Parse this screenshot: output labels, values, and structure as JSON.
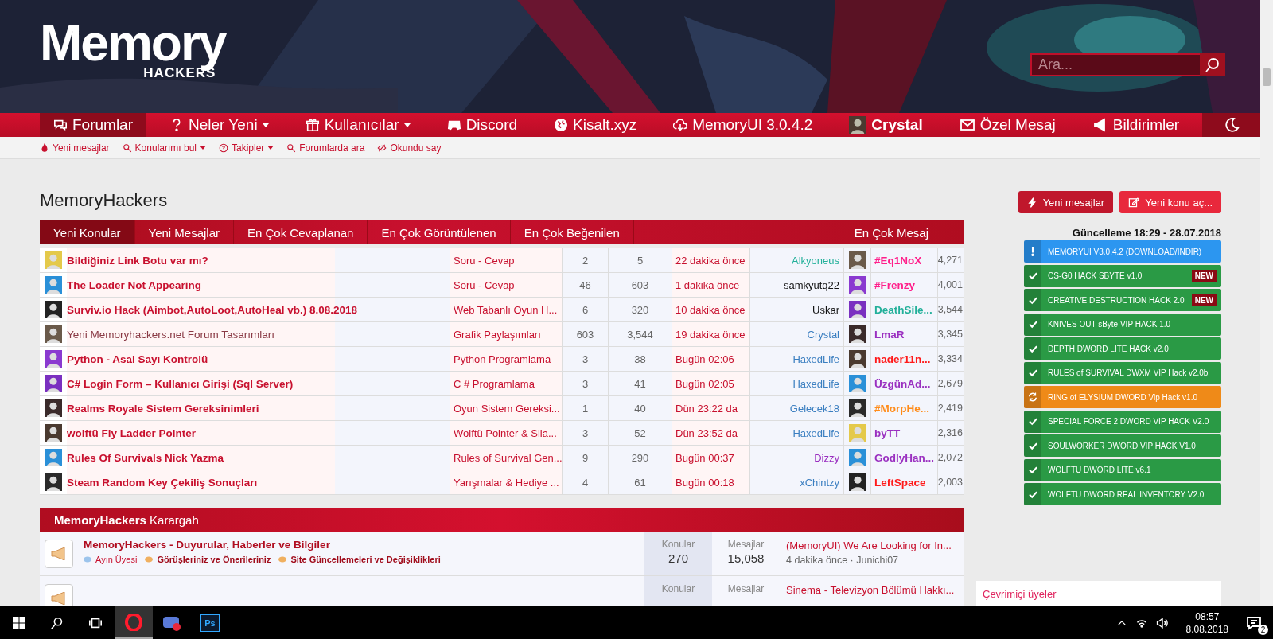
{
  "header": {
    "logo": {
      "title": "Memory",
      "subtitle": "HACKERS"
    },
    "search": {
      "placeholder": "Ara..."
    }
  },
  "nav": {
    "items": [
      {
        "label": "Forumlar",
        "selected": true,
        "dropdown": false
      },
      {
        "label": "Neler Yeni",
        "selected": false,
        "dropdown": true
      },
      {
        "label": "Kullanıcılar",
        "selected": false,
        "dropdown": true
      },
      {
        "label": "Discord",
        "selected": false,
        "dropdown": false
      },
      {
        "label": "Kisalt.xyz",
        "selected": false,
        "dropdown": false
      },
      {
        "label": "MemoryUI 3.0.4.2",
        "selected": false,
        "dropdown": false
      }
    ],
    "user": "Crystal",
    "right_items": [
      {
        "label": "Özel Mesaj"
      },
      {
        "label": "Bildirimler"
      }
    ]
  },
  "subnav": [
    {
      "label": "Yeni mesajlar",
      "dropdown": false
    },
    {
      "label": "Konularımı bul",
      "dropdown": true
    },
    {
      "label": "Takipler",
      "dropdown": true
    },
    {
      "label": "Forumlarda ara",
      "dropdown": false
    },
    {
      "label": "Okundu say",
      "dropdown": false
    }
  ],
  "page_title": "MemoryHackers",
  "action_buttons": [
    {
      "label": "Yeni mesajlar",
      "kind": "dark"
    },
    {
      "label": "Yeni konu aç...",
      "kind": "bright"
    }
  ],
  "tabs": [
    {
      "label": "Yeni Konular",
      "selected": true
    },
    {
      "label": "Yeni Mesajlar",
      "selected": false
    },
    {
      "label": "En Çok Cevaplanan",
      "selected": false
    },
    {
      "label": "En Çok Görüntülenen",
      "selected": false
    },
    {
      "label": "En Çok Beğenilen",
      "selected": false
    }
  ],
  "tabs_right": "En Çok Mesaj",
  "threads": [
    {
      "title": "Bildiğiniz Link Botu var mı?",
      "unread": true,
      "forum": "Soru - Cevap",
      "replies": "2",
      "views": "5",
      "time": "22 dakika önce",
      "user": {
        "name": "Alkyoneus",
        "color": "#22b09a"
      },
      "top_user": {
        "name": "#Eq1NoX",
        "color": "#ff1f8a",
        "count": "4,271"
      }
    },
    {
      "title": "The Loader Not Appearing",
      "unread": true,
      "forum": "Soru - Cevap",
      "replies": "46",
      "views": "603",
      "time": "1 dakika önce",
      "user": {
        "name": "samkyutq22",
        "color": "#141414"
      },
      "top_user": {
        "name": "#Frenzy",
        "color": "#ff1f8a",
        "count": "4,001"
      }
    },
    {
      "title": "Surviv.io Hack (Aimbot,AutoLoot,AutoHeal vb.) 8.08.2018",
      "unread": true,
      "forum": "Web Tabanlı Oyun H...",
      "replies": "6",
      "views": "320",
      "time": "10 dakika önce",
      "user": {
        "name": "Uskar",
        "color": "#141414"
      },
      "top_user": {
        "name": "DeathSile...",
        "color": "#22b09a",
        "count": "3,544"
      }
    },
    {
      "title": "Yeni Memoryhackers.net Forum Tasarımları",
      "unread": false,
      "forum": "Grafik Paylaşımları",
      "replies": "603",
      "views": "3,544",
      "time": "19 dakika önce",
      "user": {
        "name": "Crystal",
        "color": "#3a7ec0"
      },
      "top_user": {
        "name": "LmaR",
        "color": "#9a2fc0",
        "count": "3,345"
      }
    },
    {
      "title": "Python - Asal Sayı Kontrolü",
      "unread": true,
      "forum": "Python Programlama",
      "replies": "3",
      "views": "38",
      "time": "Bugün 02:06",
      "user": {
        "name": "HaxedLife",
        "color": "#3a7ec0"
      },
      "top_user": {
        "name": "nader11n...",
        "color": "#ff1a1a",
        "count": "3,334"
      }
    },
    {
      "title": "C# Login Form – Kullanıcı Girişi (Sql Server)",
      "unread": true,
      "forum": "C # Programlama",
      "replies": "3",
      "views": "41",
      "time": "Bugün 02:05",
      "user": {
        "name": "HaxedLife",
        "color": "#3a7ec0"
      },
      "top_user": {
        "name": "ÜzgünAd...",
        "color": "#9a2fc0",
        "count": "2,679"
      }
    },
    {
      "title": "Realms Royale Sistem Gereksinimleri",
      "unread": true,
      "forum": "Oyun Sistem Gereksi...",
      "replies": "1",
      "views": "40",
      "time": "Dün 23:22 da",
      "user": {
        "name": "Gelecek18",
        "color": "#3a7ec0"
      },
      "top_user": {
        "name": "#MorpHe...",
        "color": "#ff8c1a",
        "count": "2,419"
      }
    },
    {
      "title": "wolftü Fly Ladder Pointer",
      "unread": true,
      "forum": "Wolftü Pointer & Sila...",
      "replies": "3",
      "views": "52",
      "time": "Dün 23:52 da",
      "user": {
        "name": "HaxedLife",
        "color": "#3a7ec0"
      },
      "top_user": {
        "name": "byTT",
        "color": "#9a2fc0",
        "count": "2,316"
      }
    },
    {
      "title": "Rules Of Survivals Nick Yazma",
      "unread": true,
      "forum": "Rules of Survival Gen...",
      "replies": "9",
      "views": "290",
      "time": "Bugün 00:37",
      "user": {
        "name": "Dizzy",
        "color": "#9a2fc0"
      },
      "top_user": {
        "name": "GodlyHan...",
        "color": "#9a2fc0",
        "count": "2,072"
      }
    },
    {
      "title": "Steam Random Key Çekiliş Sonuçları",
      "unread": true,
      "forum": "Yarışmalar & Hediye ...",
      "replies": "4",
      "views": "61",
      "time": "Bugün 00:18",
      "user": {
        "name": "xChintzy",
        "color": "#3a7ec0"
      },
      "top_user": {
        "name": "LeftSpace",
        "color": "#ff1a1a",
        "count": "2,003"
      }
    }
  ],
  "forum_section": {
    "title": "**MemoryHackers** Karargah",
    "nodes": [
      {
        "title": "MemoryHackers - Duyurular, Haberler ve Bilgiler",
        "subforums": [
          {
            "label": "Ayın Üyesi",
            "unread": false
          },
          {
            "label": "Görüşleriniz ve Önerileriniz",
            "unread": true
          },
          {
            "label": "Site Güncellemeleri ve Değişiklikleri",
            "unread": true
          }
        ],
        "stats": [
          {
            "label": "Konular",
            "value": "270"
          },
          {
            "label": "Mesajlar",
            "value": "15,058"
          }
        ],
        "last_post": {
          "title": "(MemoryUI) We Are Looking for In...",
          "meta": "4 dakika önce · Junichi07"
        }
      },
      {
        "stats": [
          {
            "label": "Konular"
          },
          {
            "label": "Mesajlar"
          }
        ],
        "last_post": {
          "title": "Sinema - Televizyon Bölümü Hakkı..."
        }
      }
    ]
  },
  "updates": {
    "heading": "Güncelleme 18:29 - 28.07.2018",
    "items": [
      {
        "label": "MEMORYUI V3.0.4.2 (DOWNLOAD/INDIR)",
        "kind": "info"
      },
      {
        "label": "CS-G0 HACK SBYTE v1.0",
        "kind": "done",
        "badge": "NEW"
      },
      {
        "label": "CREATIVE DESTRUCTION HACK 2.0",
        "kind": "done",
        "badge": "NEW"
      },
      {
        "label": "KNIVES OUT sByte VIP HACK 1.0",
        "kind": "done"
      },
      {
        "label": "DEPTH DWORD LITE HACK v2.0",
        "kind": "done"
      },
      {
        "label": "RULES of SURVIVAL DWXM VIP Hack v2.0b",
        "kind": "done"
      },
      {
        "label": "RING of ELYSIUM DWORD Vip Hack v1.0",
        "kind": "updating"
      },
      {
        "label": "SPECIAL FORCE 2 DWORD VIP HACK V2.0",
        "kind": "done"
      },
      {
        "label": "SOULWORKER DWORD VIP HACK V1.0",
        "kind": "done"
      },
      {
        "label": "WOLFTU DWORD LITE v6.1",
        "kind": "done"
      },
      {
        "label": "WOLFTU DWORD REAL INVENTORY V2.0",
        "kind": "done"
      }
    ]
  },
  "online_users": {
    "title": "Çevrimiçi üyeler"
  },
  "taskbar": {
    "apps": [
      {
        "kind": "browser",
        "selected": true
      },
      {
        "kind": "game",
        "selected": false
      },
      {
        "kind": "editor",
        "label": "Ps",
        "selected": false
      }
    ],
    "time": "08:57",
    "date": "8.08.2018",
    "notifications": "2"
  }
}
